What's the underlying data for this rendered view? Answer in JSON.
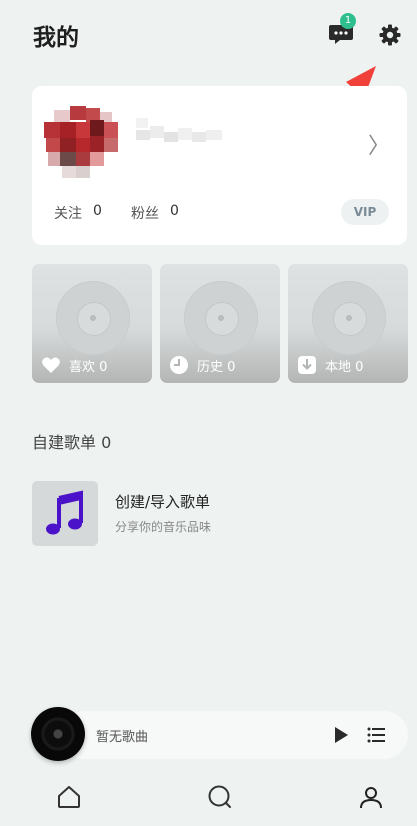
{
  "header": {
    "title": "我的",
    "message_badge": "1"
  },
  "profile": {
    "follow_label": "关注",
    "follow_count": "0",
    "fans_label": "粉丝",
    "fans_count": "0",
    "vip_label": "VIP",
    "chevron": "〉"
  },
  "tiles": [
    {
      "icon": "heart-icon",
      "label": "喜欢 0"
    },
    {
      "icon": "clock-icon",
      "label": "历史 0"
    },
    {
      "icon": "download-icon",
      "label": "本地 0"
    }
  ],
  "playlists": {
    "section_title": "自建歌单 0",
    "create_title": "创建/导入歌单",
    "create_subtitle": "分享你的音乐品味"
  },
  "player": {
    "status_text": "暂无歌曲"
  },
  "bottom_nav": [
    {
      "icon": "home-icon"
    },
    {
      "icon": "search-icon"
    },
    {
      "icon": "profile-icon"
    }
  ],
  "colors": {
    "accent": "#2fbf8f",
    "arrow": "#f0403a",
    "note": "#4b13c9"
  }
}
